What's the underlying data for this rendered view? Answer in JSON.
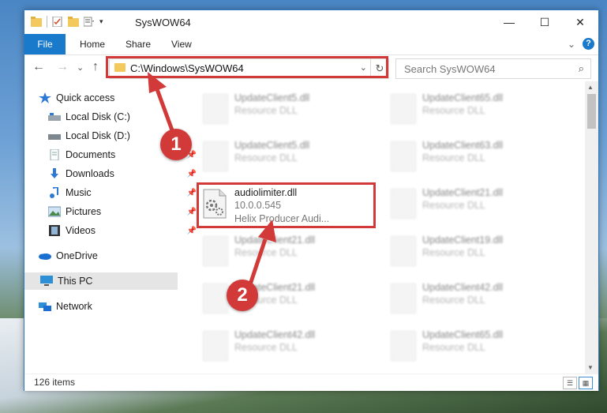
{
  "window": {
    "title": "SysWOW64",
    "controls": {
      "minimize": "—",
      "maximize": "☐",
      "close": "✕"
    }
  },
  "ribbon": {
    "tabs": [
      "File",
      "Home",
      "Share",
      "View"
    ],
    "help": "?",
    "collapse": "⌄"
  },
  "navigation": {
    "back": "←",
    "forward": "→",
    "recent": "⌄",
    "up": "↑",
    "address": "C:\\Windows\\SysWOW64",
    "refresh": "↻",
    "search_placeholder": "Search SysWOW64"
  },
  "sidebar": {
    "items": [
      {
        "label": "Quick access",
        "icon": "star-icon"
      },
      {
        "label": "Local Disk (C:)",
        "icon": "drive-icon",
        "pinned": true
      },
      {
        "label": "Local Disk (D:)",
        "icon": "drive-icon",
        "pinned": true
      },
      {
        "label": "Documents",
        "icon": "document-icon",
        "pinned": true
      },
      {
        "label": "Downloads",
        "icon": "download-icon",
        "pinned": true
      },
      {
        "label": "Music",
        "icon": "music-icon",
        "pinned": true
      },
      {
        "label": "Pictures",
        "icon": "picture-icon",
        "pinned": true
      },
      {
        "label": "Videos",
        "icon": "video-icon",
        "pinned": true
      },
      {
        "label": "OneDrive",
        "icon": "cloud-icon"
      },
      {
        "label": "This PC",
        "icon": "computer-icon",
        "selected": true
      },
      {
        "label": "Network",
        "icon": "network-icon"
      }
    ]
  },
  "files": {
    "highlighted": {
      "name": "audiolimiter.dll",
      "version": "10.0.0.545",
      "description": "Helix Producer Audi..."
    },
    "left_column": [
      {
        "name": "UpdateClient5.dll",
        "type": "Resource DLL"
      },
      {
        "name": "UpdateClient5.dll",
        "type": "Resource DLL"
      },
      {
        "name": "UpdateClient21.dll",
        "type": "Resource DLL"
      },
      {
        "name": "UpdateClient21.dll",
        "type": "Resource DLL"
      },
      {
        "name": "UpdateClient42.dll",
        "type": "Resource DLL"
      }
    ],
    "right_column": [
      {
        "name": "UpdateClient65.dll",
        "type": "Resource DLL"
      },
      {
        "name": "UpdateClient63.dll",
        "type": "Resource DLL"
      },
      {
        "name": "UpdateClient21.dll",
        "type": "Resource DLL"
      },
      {
        "name": "UpdateClient19.dll",
        "type": "Resource DLL"
      },
      {
        "name": "UpdateClient42.dll",
        "type": "Resource DLL"
      },
      {
        "name": "UpdateClient65.dll",
        "type": "Resource DLL"
      }
    ]
  },
  "status": {
    "item_count": "126 items"
  },
  "annotations": {
    "step1": "1",
    "step2": "2",
    "color": "#d23a3a"
  }
}
